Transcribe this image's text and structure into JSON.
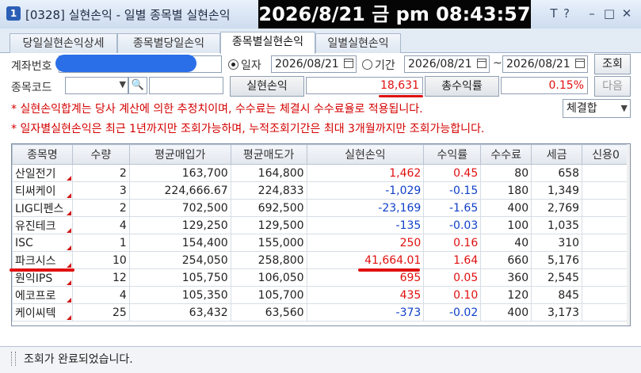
{
  "window": {
    "badge": "1",
    "title": "[0328] 실현손익 - 일별 종목별 실현손익",
    "clock": "2026/8/21 금 pm 08:43:57",
    "buttons": {
      "settings": "T",
      "help": "?",
      "minimize": "–",
      "maximize": "□",
      "close": "✕"
    }
  },
  "tabs": [
    {
      "label": "당일실현손익상세",
      "active": false
    },
    {
      "label": "종목별당일손익",
      "active": false
    },
    {
      "label": "종목별실현손익",
      "active": true
    },
    {
      "label": "일별실현손익",
      "active": false
    }
  ],
  "form": {
    "account_label": "계좌번호",
    "account_value": "",
    "radio_date": "일자",
    "radio_period": "기간",
    "radio_selected": "일자",
    "date_single": "2026/08/21",
    "period_from": "2026/08/21",
    "period_sep": "~",
    "period_to": "2026/08/21",
    "query_button": "조회",
    "stock_code_label": "종목코드",
    "stock_code_value": "",
    "realized_label": "실현손익",
    "realized_value": "18,631",
    "return_label": "총수익률",
    "return_value": "0.15%",
    "next_button": "다음",
    "fee_select": "체결합"
  },
  "notices": [
    "* 실현손익합계는 당사 계산에 의한 추정치이며, 수수료는 체결시 수수료율로 적용됩니다.",
    "* 일자별실현손익은 최근 1년까지만 조회가능하며, 누적조회기간은 최대 3개월까지만 조회가능합니다."
  ],
  "grid": {
    "columns": [
      "종목명",
      "수량",
      "평균매입가",
      "평균매도가",
      "실현손익",
      "수익률",
      "수수료",
      "세금",
      "신용0"
    ],
    "rows": [
      {
        "name": "산일전기",
        "qty": "2",
        "avg_buy": "163,700",
        "avg_sell": "164,800",
        "pnl": "1,462",
        "rate": "0.45",
        "fee": "80",
        "tax": "658",
        "credit": "",
        "sign": "pos"
      },
      {
        "name": "티써케이",
        "qty": "3",
        "avg_buy": "224,666.67",
        "avg_sell": "224,833",
        "pnl": "-1,029",
        "rate": "-0.15",
        "fee": "180",
        "tax": "1,349",
        "credit": "",
        "sign": "neg"
      },
      {
        "name": "LIG디펜스",
        "qty": "2",
        "avg_buy": "702,500",
        "avg_sell": "692,500",
        "pnl": "-23,169",
        "rate": "-1.65",
        "fee": "400",
        "tax": "2,769",
        "credit": "",
        "sign": "neg"
      },
      {
        "name": "유진테크",
        "qty": "4",
        "avg_buy": "129,250",
        "avg_sell": "129,500",
        "pnl": "-135",
        "rate": "-0.03",
        "fee": "100",
        "tax": "1,035",
        "credit": "",
        "sign": "neg"
      },
      {
        "name": "ISC",
        "qty": "1",
        "avg_buy": "154,400",
        "avg_sell": "155,000",
        "pnl": "250",
        "rate": "0.16",
        "fee": "40",
        "tax": "310",
        "credit": "",
        "sign": "pos"
      },
      {
        "name": "파크시스",
        "qty": "10",
        "avg_buy": "254,050",
        "avg_sell": "258,800",
        "pnl": "41,664.01",
        "rate": "1.64",
        "fee": "660",
        "tax": "5,176",
        "credit": "",
        "sign": "pos"
      },
      {
        "name": "원익IPS",
        "qty": "12",
        "avg_buy": "105,750",
        "avg_sell": "106,050",
        "pnl": "695",
        "rate": "0.05",
        "fee": "360",
        "tax": "2,545",
        "credit": "",
        "sign": "pos"
      },
      {
        "name": "에코프로",
        "qty": "4",
        "avg_buy": "105,350",
        "avg_sell": "105,700",
        "pnl": "435",
        "rate": "0.10",
        "fee": "120",
        "tax": "845",
        "credit": "",
        "sign": "pos"
      },
      {
        "name": "케이씨텍",
        "qty": "25",
        "avg_buy": "63,432",
        "avg_sell": "63,560",
        "pnl": "-373",
        "rate": "-0.02",
        "fee": "400",
        "tax": "3,173",
        "credit": "",
        "sign": "neg"
      }
    ]
  },
  "status": {
    "message": "조회가 완료되었습니다."
  },
  "colors": {
    "positive": "#e01010",
    "negative": "#1040c8",
    "notice": "#d40000",
    "highlight_underline": "#e01010",
    "account_mask": "#2b6fe8"
  }
}
